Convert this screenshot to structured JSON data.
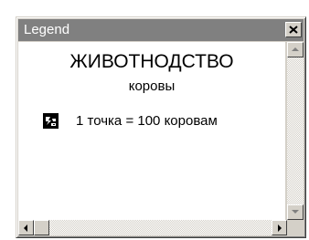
{
  "window": {
    "title": "Legend",
    "close_icon": "close-x-icon"
  },
  "legend": {
    "heading": "ЖИВОТНОДСТВО",
    "subheading": "коровы",
    "items": [
      {
        "symbol_icon": "dot-density-symbol-icon",
        "label": "1 точка = 100 коровам"
      }
    ]
  },
  "scrollbars": {
    "vertical_icons": [
      "arrow-up-icon",
      "arrow-down-icon"
    ],
    "horizontal_icons": [
      "arrow-left-icon",
      "arrow-right-icon"
    ]
  },
  "colors": {
    "title_bar": "#808080",
    "title_text": "#ffffff",
    "chrome": "#d4d0c8",
    "content": "#ffffff"
  }
}
